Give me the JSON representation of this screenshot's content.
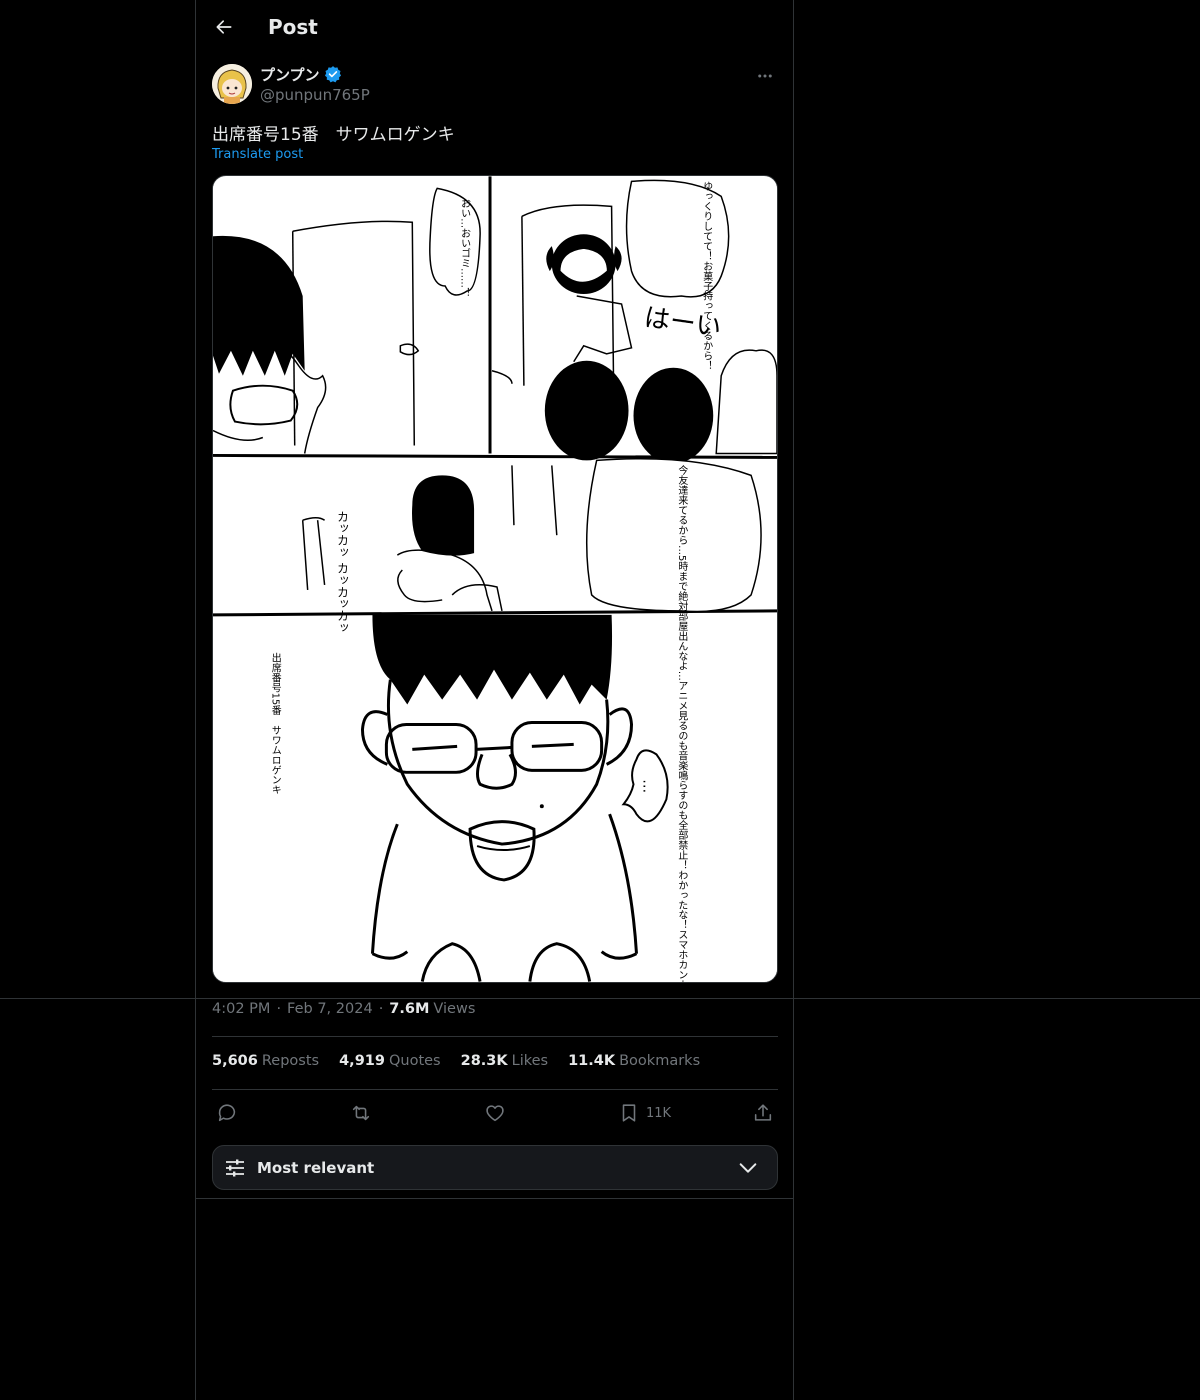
{
  "header": {
    "title": "Post"
  },
  "author": {
    "display_name": "プンプン",
    "handle": "@punpun765P"
  },
  "post": {
    "text": "出席番号15番　サワムロゲンキ",
    "translate_label": "Translate post",
    "time": "4:02 PM",
    "date": "Feb 7, 2024",
    "views_count": "7.6M",
    "views_label": "Views"
  },
  "stats": [
    {
      "count": "5,606",
      "label": "Reposts"
    },
    {
      "count": "4,919",
      "label": "Quotes"
    },
    {
      "count": "28.3K",
      "label": "Likes"
    },
    {
      "count": "11.4K",
      "label": "Bookmarks"
    }
  ],
  "actions": {
    "bookmark_count": "11K"
  },
  "sort": {
    "label": "Most relevant"
  },
  "comic": {
    "panel1_left": "おい…おいゴミ……！",
    "panel1_right": "ゆっくりしてて！お菓子持ってくるから！",
    "panel1_sfx": "はーい",
    "panel2_sfx": "カッカッ カッカッカッ",
    "panel2_text": "今友達来てるから…5時まで絶対部屋出んなよ…アニメ見るのも音楽鳴らすのも全部禁止！わかったな！スマホカンカン叩くのもやめろよ！",
    "panel3_caption": "出席番号15番　サワムロゲンキ",
    "panel3_bubble": "…"
  },
  "colors": {
    "accent": "#1d9bf0",
    "text": "#e7e9ea",
    "muted": "#71767b",
    "border": "#2f3336",
    "background": "#000000"
  },
  "icons": [
    "back-arrow-icon",
    "verified-badge-icon",
    "more-dots-icon",
    "reply-icon",
    "repost-icon",
    "like-icon",
    "bookmark-icon",
    "share-icon",
    "filter-sliders-icon",
    "chevron-down-icon"
  ]
}
